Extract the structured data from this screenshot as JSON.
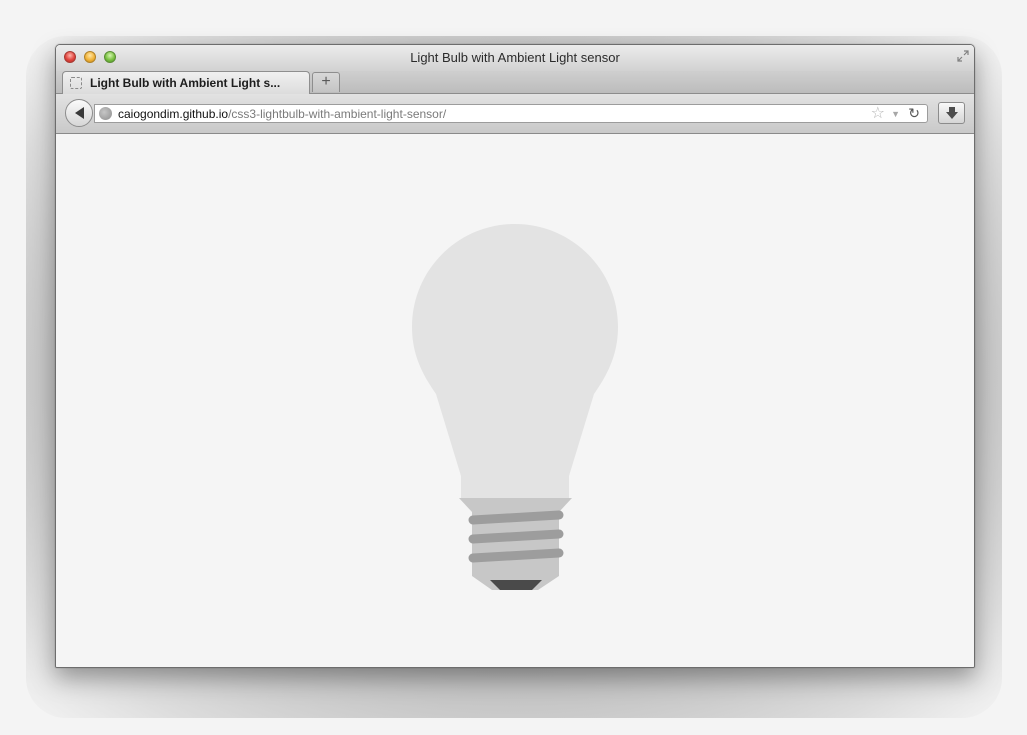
{
  "window": {
    "title": "Light Bulb with Ambient Light sensor"
  },
  "tabs": [
    {
      "label": "Light Bulb with Ambient Light s...",
      "active": true
    }
  ],
  "new_tab_label": "+",
  "address_bar": {
    "host": "caiogondim.github.io",
    "path": "/css3-lightbulb-with-ambient-light-sensor/"
  },
  "icons": {
    "traffic_lights": [
      "close-icon",
      "minimize-icon",
      "maximize-icon"
    ],
    "fullscreen": "fullscreen-icon",
    "back": "back-arrow-icon",
    "site": "globe-icon",
    "bookmark": "star-icon",
    "history": "dropdown-icon",
    "reload": "reload-icon",
    "downloads": "download-icon"
  },
  "colors": {
    "bulb_glass": "#e3e3e3",
    "bulb_base": "#c7c7c7",
    "bulb_threads": "#9d9d9d",
    "bulb_tip": "#4a4a4a",
    "page_background": "#f5f5f5"
  }
}
